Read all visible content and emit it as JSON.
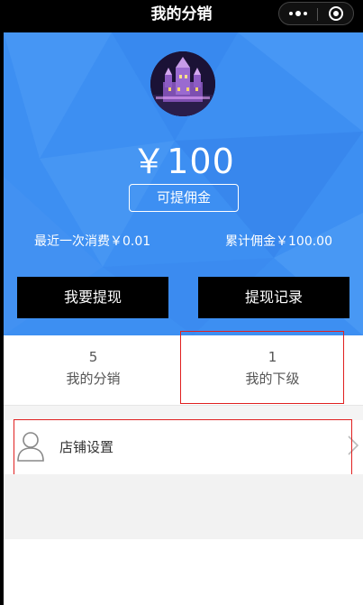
{
  "nav": {
    "title": "我的分销",
    "more_icon": "more-dots-icon",
    "close_icon": "target-circle-icon"
  },
  "hero": {
    "amount": "￥100",
    "withdrawable_button": "可提佣金",
    "recent_spend": "最近一次消费￥0.01",
    "total_commission": "累计佣金￥100.00",
    "withdraw_button": "我要提现",
    "records_button": "提现记录",
    "accent_color": "#3d8ff2"
  },
  "tabs": [
    {
      "count": "5",
      "label": "我的分销"
    },
    {
      "count": "1",
      "label": "我的下级"
    }
  ],
  "shop": {
    "label": "店铺设置",
    "icon": "user-outline-icon",
    "arrow": "chevron-right-icon"
  }
}
